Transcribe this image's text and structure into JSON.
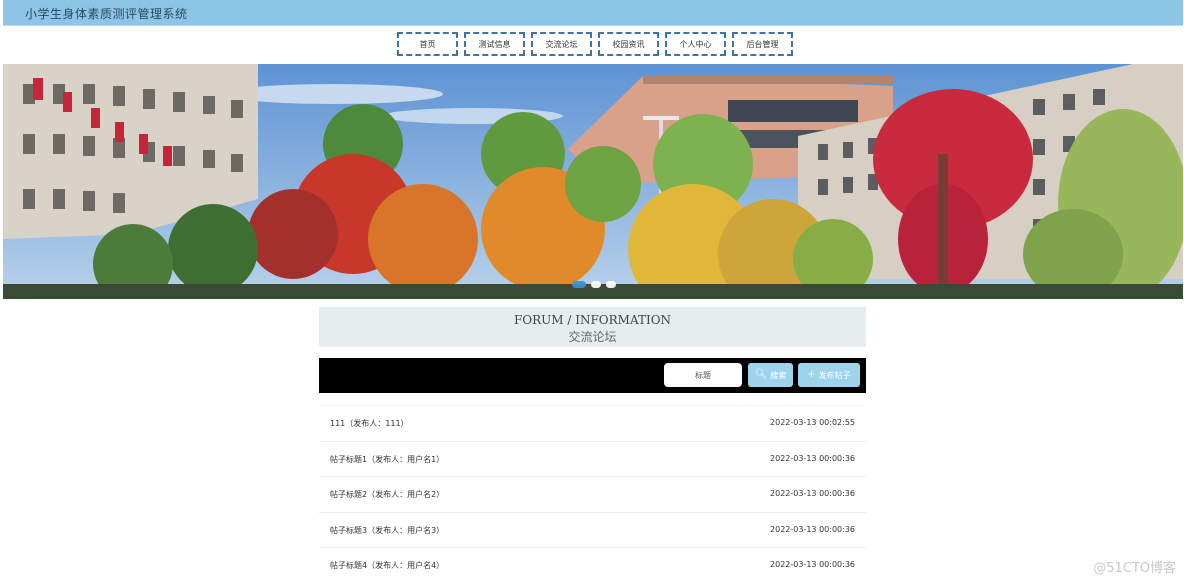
{
  "header": {
    "app_title": "小学生身体素质测评管理系统"
  },
  "nav": {
    "items": [
      {
        "label": "首页"
      },
      {
        "label": "测试信息"
      },
      {
        "label": "交流论坛"
      },
      {
        "label": "校园资讯"
      },
      {
        "label": "个人中心"
      },
      {
        "label": "后台管理"
      }
    ]
  },
  "banner": {
    "slides": 3,
    "active_slide": 1
  },
  "forum": {
    "title_en": "FORUM / INFORMATION",
    "title_cn": "交流论坛"
  },
  "search": {
    "placeholder": "标题",
    "search_label": "搜索",
    "post_label": "发布帖子",
    "accent_color": "#9fd3ec"
  },
  "posts": [
    {
      "title": "111（发布人：111）",
      "time": "2022-03-13 00:02:55"
    },
    {
      "title": "帖子标题1（发布人：用户名1）",
      "time": "2022-03-13 00:00:36"
    },
    {
      "title": "帖子标题2（发布人：用户名2）",
      "time": "2022-03-13 00:00:36"
    },
    {
      "title": "帖子标题3（发布人：用户名3）",
      "time": "2022-03-13 00:00:36"
    },
    {
      "title": "帖子标题4（发布人：用户名4）",
      "time": "2022-03-13 00:00:36"
    }
  ],
  "watermark": "@51CTO博客"
}
